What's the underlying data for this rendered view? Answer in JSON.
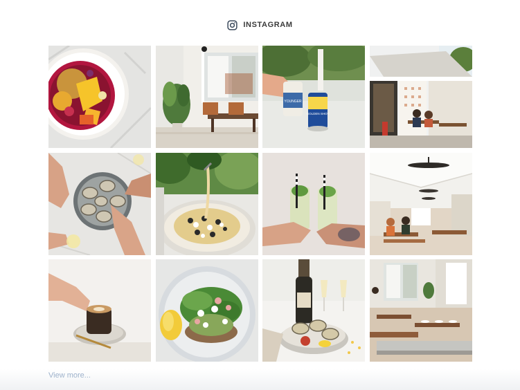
{
  "header": {
    "icon": "instagram-icon",
    "title": "INSTAGRAM"
  },
  "feed": {
    "posts": [
      {
        "subject": "acai-bowl",
        "can_label_1": "",
        "can_label_2": ""
      },
      {
        "subject": "cafe-interior-window-plant"
      },
      {
        "subject": "hands-holding-cans",
        "can_label_1": "YOUNGER",
        "can_label_2": "GOLDEN SHOT"
      },
      {
        "subject": "cafe-exterior-street"
      },
      {
        "subject": "oysters-platter-hands"
      },
      {
        "subject": "pasta-dish"
      },
      {
        "subject": "mojito-cheers"
      },
      {
        "subject": "restaurant-interior-ceiling-fan"
      },
      {
        "subject": "latte-coffee-glass"
      },
      {
        "subject": "avocado-toast-salad"
      },
      {
        "subject": "champagne-oysters"
      },
      {
        "subject": "restaurant-dining-room"
      }
    ]
  },
  "footer": {
    "view_more_label": "View more..."
  },
  "colors": {
    "link": "#8aa3c2",
    "header_text": "#3a3a3a",
    "icon": "#3b4a5c"
  }
}
